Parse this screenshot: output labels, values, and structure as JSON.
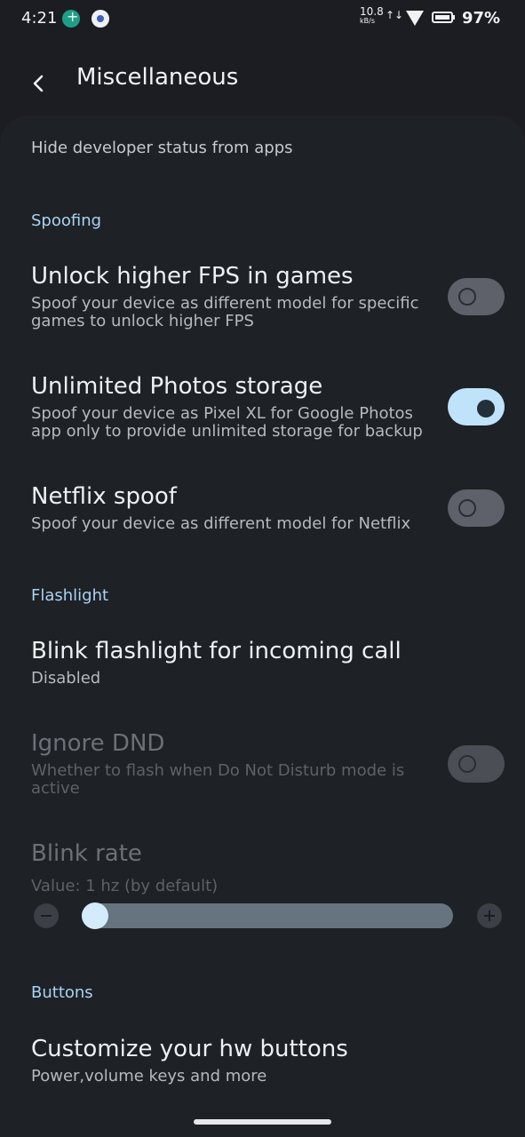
{
  "status": {
    "time": "4:21",
    "net_speed": "10.8",
    "net_unit": "kB/s",
    "battery": "97%"
  },
  "header": {
    "title": "Miscellaneous"
  },
  "partial_item": "Hide developer status from apps",
  "sections": {
    "spoofing": "Spoofing",
    "flashlight": "Flashlight",
    "buttons": "Buttons"
  },
  "prefs": {
    "fps": {
      "title": "Unlock higher FPS in games",
      "summary": "Spoof your device as different model for specific games to unlock higher FPS",
      "checked": false
    },
    "photos": {
      "title": "Unlimited Photos storage",
      "summary": "Spoof your device as Pixel XL for Google Photos app only to provide unlimited storage for backup",
      "checked": true
    },
    "netflix": {
      "title": "Netflix spoof",
      "summary": "Spoof your device as different model for Netflix",
      "checked": false
    },
    "blink_call": {
      "title": "Blink flashlight for incoming call",
      "summary": "Disabled"
    },
    "ignore_dnd": {
      "title": "Ignore DND",
      "summary": "Whether to flash when Do Not Disturb mode is active",
      "checked": false,
      "enabled": false
    },
    "blink_rate": {
      "title": "Blink rate",
      "summary": "Value: 1 hz (by default)",
      "level": 0,
      "enabled": false
    },
    "hw_buttons": {
      "title": "Customize your hw buttons",
      "summary": "Power,volume keys and more"
    }
  }
}
